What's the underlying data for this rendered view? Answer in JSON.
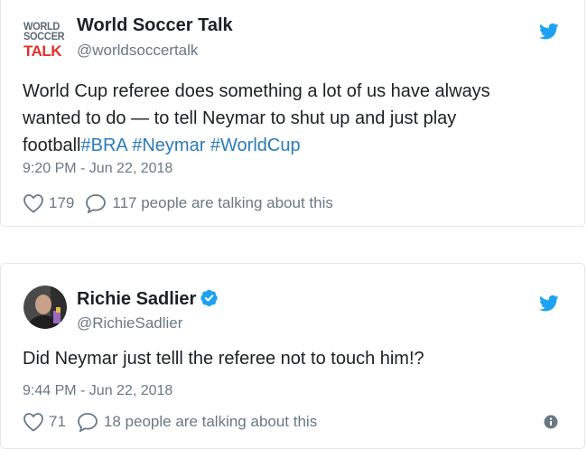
{
  "colors": {
    "twitter_blue": "#1da1f2",
    "link": "#2b7bb9",
    "muted": "#697882",
    "text": "#1c2022",
    "border": "#e1e8ed",
    "logo_gray": "#5d6a73",
    "logo_red": "#e0312a"
  },
  "tweets": [
    {
      "avatar_logo": {
        "line1": "WORLD",
        "line2": "SOCCER",
        "line3": "TALK"
      },
      "display_name": "World Soccer Talk",
      "handle": "@worldsoccertalk",
      "verified": false,
      "text": "World Cup referee does something a lot of us have always wanted to do — to tell Neymar to shut up and just play football",
      "hashtags": [
        "#BRA",
        "#Neymar",
        "#WorldCup"
      ],
      "timestamp": "9:20 PM - Jun 22, 2018",
      "likes": "179",
      "talking": "117 people are talking about this",
      "icons": [
        "twitter-bird-icon",
        "heart-icon",
        "reply-icon"
      ]
    },
    {
      "display_name": "Richie Sadlier",
      "handle": "@RichieSadlier",
      "verified": true,
      "text": "Did Neymar just telll the referee not to touch him!?",
      "timestamp": "9:44 PM - Jun 22, 2018",
      "likes": "71",
      "talking": "18 people are talking about this",
      "icons": [
        "twitter-bird-icon",
        "verified-badge-icon",
        "heart-icon",
        "reply-icon",
        "info-icon"
      ]
    }
  ]
}
